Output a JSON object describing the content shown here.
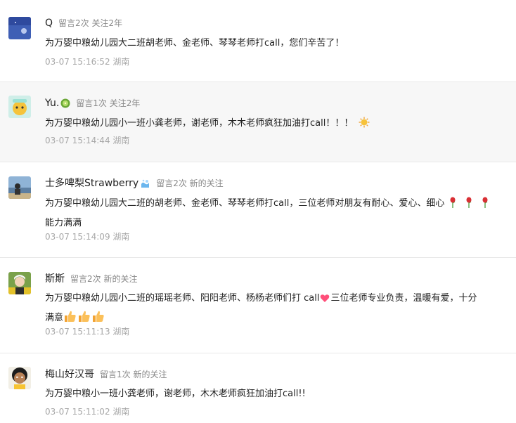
{
  "comments": [
    {
      "nickname": "Q",
      "stats": "留言2次 关注2年",
      "content": "为万婴中粮幼儿园大二班胡老师、金老师、琴琴老师打call，您们辛苦了！",
      "time": "03-07 15:16:52",
      "region": "湖南",
      "avatar_icon": "blue-sky-avatar"
    },
    {
      "nickname": "Yu.",
      "stats": "留言1次 关注2年",
      "content": "为万婴中粮幼儿园小一班小龚老师，谢老师，木木老师疯狂加油打call！！！",
      "time": "03-07 15:14:44",
      "region": "湖南",
      "avatar_icon": "yellow-cartoon-avatar",
      "name_emoji": "kiwi-emoji",
      "content_emoji": "sun-emoji"
    },
    {
      "nickname": "士多啤梨Strawberry",
      "stats": "留言2次 新的关注",
      "content_line1": "为万婴中粮幼儿园大二班的胡老师、金老师、琴琴老师打call，三位老师对朋友有耐心、爱心、细心",
      "content_line2": "能力满满",
      "time": "03-07 15:14:09",
      "region": "湖南",
      "avatar_icon": "beach-photo-avatar",
      "name_emoji": "water-emoji",
      "content_emoji": "rose-emoji"
    },
    {
      "nickname": "斯斯",
      "stats": "留言2次 新的关注",
      "content_a": "为万婴中粮幼儿园小二班的瑶瑶老师、阳阳老师、杨杨老师们打 call",
      "content_b": "三位老师专业负责，温暖有爱，十分",
      "content_line2": "满意",
      "time": "03-07 15:11:13",
      "region": "湖南",
      "avatar_icon": "person-photo-avatar",
      "content_emoji_a": "heart-emoji",
      "content_emoji_b": "thumbs-up-emoji"
    },
    {
      "nickname": "梅山好汉哥",
      "stats": "留言1次 新的关注",
      "content": "为万婴中粮小一班小龚老师，谢老师，木木老师疯狂加油打call!!",
      "time": "03-07 15:11:02",
      "region": "湖南",
      "avatar_icon": "cartoon-man-avatar"
    }
  ]
}
